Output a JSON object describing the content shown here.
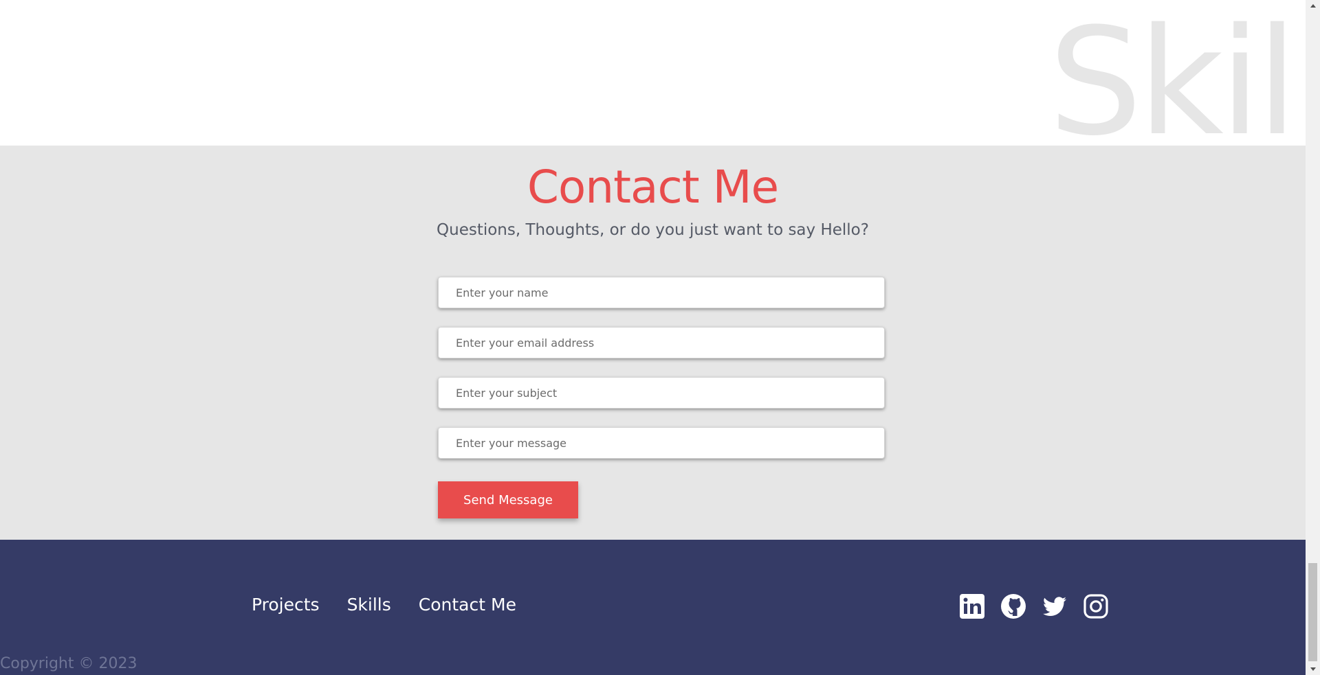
{
  "hero": {
    "background_word": "Skill"
  },
  "contact": {
    "title": "Contact Me",
    "subtitle": "Questions, Thoughts, or do you just want to say Hello?",
    "fields": {
      "name_placeholder": "Enter your name",
      "email_placeholder": "Enter your email address",
      "subject_placeholder": "Enter your subject",
      "message_placeholder": "Enter your message"
    },
    "submit_label": "Send Message"
  },
  "footer": {
    "nav": [
      "Projects",
      "Skills",
      "Contact Me"
    ],
    "socials": [
      "linkedin-icon",
      "github-icon",
      "twitter-icon",
      "instagram-icon"
    ],
    "copyright": "Copyright © 2023"
  },
  "colors": {
    "accent": "#e84c4c",
    "contact_bg": "#e6e6e6",
    "footer_bg": "#353b66",
    "background_word": "#e6e6e6"
  }
}
